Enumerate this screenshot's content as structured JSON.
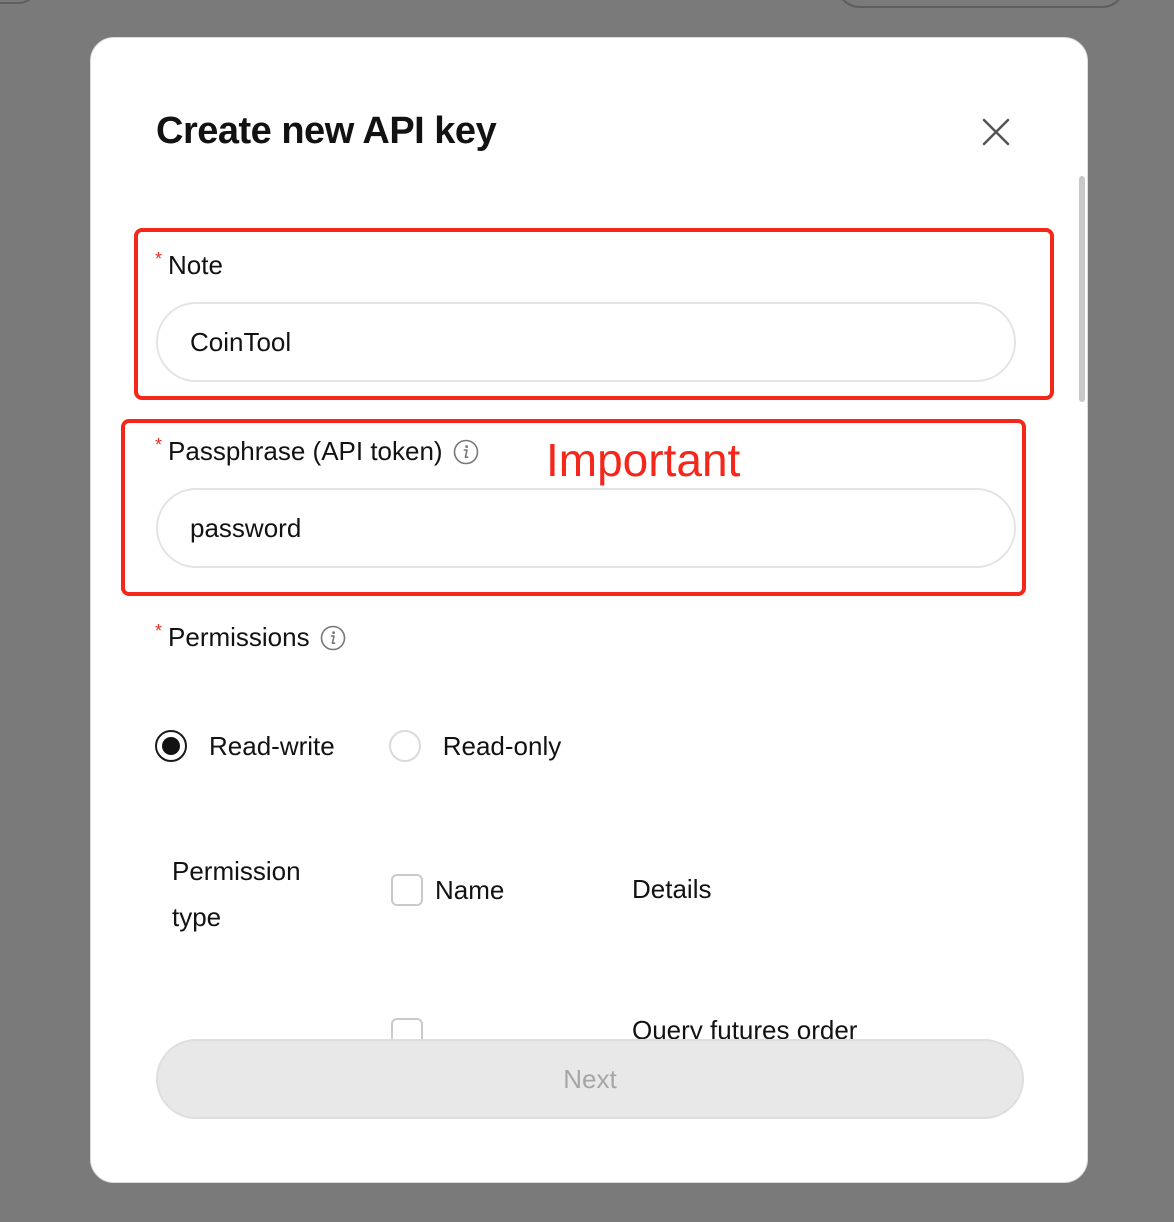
{
  "modal": {
    "title": "Create new API key"
  },
  "form": {
    "note": {
      "required_mark": "*",
      "label": "Note",
      "value": "CoinTool"
    },
    "passphrase": {
      "required_mark": "*",
      "label": "Passphrase (API token)",
      "value": "password",
      "info_icon": "info-icon"
    },
    "permissions": {
      "required_mark": "*",
      "label": "Permissions",
      "info_icon": "info-icon",
      "options": [
        {
          "label": "Read-write",
          "selected": true
        },
        {
          "label": "Read-only",
          "selected": false
        }
      ]
    },
    "permission_table": {
      "headers": {
        "type": "Permission type",
        "name": "Name",
        "details": "Details"
      },
      "rows": [
        {
          "details": "Query futures order"
        }
      ]
    }
  },
  "annotation": {
    "text": "Important",
    "color": "#f5271b"
  },
  "footer": {
    "next_label": "Next"
  },
  "colors": {
    "accent_required": "#e5302a",
    "annotation_red": "#f5271b",
    "disabled_button_bg": "#e8e8e8",
    "overlay_bg": "#7a7a7a"
  }
}
